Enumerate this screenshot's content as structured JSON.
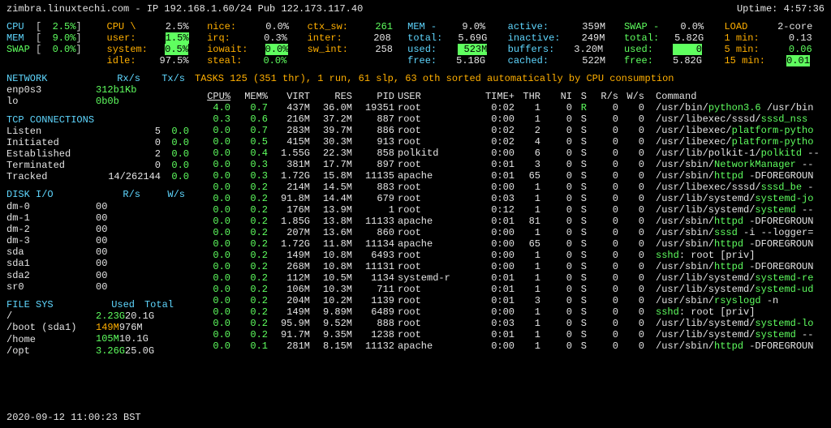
{
  "header": {
    "host": "zimbra.linuxtechi.com - IP 192.168.1.60/24 Pub 122.173.117.40",
    "uptime_label": "Uptime:",
    "uptime": "4:57:36"
  },
  "meters": {
    "cpu0": {
      "label": "CPU",
      "val": "2.5%"
    },
    "mem0": {
      "label": "MEM",
      "val": "9.0%"
    },
    "swap0": {
      "label": "SWAP",
      "val": "0.0%"
    },
    "cpu": {
      "label": "CPU \\",
      "val": "2.5%",
      "user": "user:",
      "user_v": "1.5%",
      "system": "system:",
      "system_v": "0.5%",
      "idle": "idle:",
      "idle_v": "97.5%"
    },
    "mid": {
      "nice": "nice:",
      "nice_v": "0.0%",
      "irq": "irq:",
      "irq_v": "0.3%",
      "iowait": "iowait:",
      "iowait_v": "0.0%",
      "steal": "steal:",
      "steal_v": "0.0%"
    },
    "ctx": {
      "ctx": "ctx_sw:",
      "ctx_v": "261",
      "inter": "inter:",
      "inter_v": "208",
      "swint": "sw_int:",
      "swint_v": "258"
    },
    "memd": {
      "label": "MEM -",
      "val": "9.0%",
      "total": "total:",
      "total_v": "5.69G",
      "used": "used:",
      "used_v": "523M",
      "free": "free:",
      "free_v": "5.18G"
    },
    "act": {
      "active": "active:",
      "active_v": "359M",
      "inactive": "inactive:",
      "inactive_v": "249M",
      "buffers": "buffers:",
      "buffers_v": "3.20M",
      "cached": "cached:",
      "cached_v": "522M"
    },
    "swap": {
      "label": "SWAP -",
      "val": "0.0%",
      "total": "total:",
      "total_v": "5.82G",
      "used": "used:",
      "used_v": "0",
      "free": "free:",
      "free_v": "5.82G"
    },
    "load": {
      "label": "LOAD",
      "cores": "2-core",
      "m1": "1 min:",
      "m1_v": "0.13",
      "m5": "5 min:",
      "m5_v": "0.06",
      "m15": "15 min:",
      "m15_v": "0.01"
    }
  },
  "network": {
    "title": "NETWORK",
    "rx": "Rx/s",
    "tx": "Tx/s",
    "rows": [
      {
        "if": "enp0s3",
        "rx": "312b",
        "tx": "1Kb"
      },
      {
        "if": "lo",
        "rx": "0b",
        "tx": "0b"
      }
    ]
  },
  "tcp": {
    "title": "TCP CONNECTIONS",
    "rows": [
      {
        "k": "Listen",
        "a": "5",
        "b": "0.0"
      },
      {
        "k": "Initiated",
        "a": "0",
        "b": "0.0"
      },
      {
        "k": "Established",
        "a": "2",
        "b": "0.0"
      },
      {
        "k": "Terminated",
        "a": "0",
        "b": "0.0"
      },
      {
        "k": "Tracked",
        "a": "14/262144",
        "b": "0.0"
      }
    ]
  },
  "disk": {
    "title": "DISK I/O",
    "r": "R/s",
    "w": "W/s",
    "rows": [
      {
        "d": "dm-0",
        "r": "0",
        "w": "0"
      },
      {
        "d": "dm-1",
        "r": "0",
        "w": "0"
      },
      {
        "d": "dm-2",
        "r": "0",
        "w": "0"
      },
      {
        "d": "dm-3",
        "r": "0",
        "w": "0"
      },
      {
        "d": "sda",
        "r": "0",
        "w": "0"
      },
      {
        "d": "sda1",
        "r": "0",
        "w": "0"
      },
      {
        "d": "sda2",
        "r": "0",
        "w": "0"
      },
      {
        "d": "sr0",
        "r": "0",
        "w": "0"
      }
    ]
  },
  "fs": {
    "title": "FILE SYS",
    "used": "Used",
    "total": "Total",
    "rows": [
      {
        "m": "/",
        "u": "2.23G",
        "t": "20.1G",
        "c": "gr"
      },
      {
        "m": "/boot (sda1)",
        "u": "149M",
        "t": "976M",
        "c": "ye"
      },
      {
        "m": "/home",
        "u": "105M",
        "t": "10.1G",
        "c": "gr"
      },
      {
        "m": "/opt",
        "u": "3.26G",
        "t": "25.0G",
        "c": "gr"
      }
    ]
  },
  "tasks": {
    "line": "TASKS 125 (351 thr), 1 run, 61 slp, 63 oth sorted automatically by CPU consumption"
  },
  "ph": {
    "cpu": "CPU%",
    "mem": "MEM%",
    "virt": "VIRT",
    "res": "RES",
    "pid": "PID",
    "user": "USER",
    "time": "TIME+",
    "thr": "THR",
    "ni": "NI",
    "s": "S",
    "rs": "R/s",
    "ws": "W/s",
    "cmd": "Command"
  },
  "procs": [
    {
      "cpu": "4.0",
      "mem": "0.7",
      "virt": "437M",
      "res": "36.0M",
      "pid": "19351",
      "user": "root",
      "time": "0:02",
      "thr": "1",
      "ni": "0",
      "s": "R",
      "rs": "0",
      "ws": "0",
      "cmd": [
        "/usr/bin/",
        "python3.6",
        " /usr/bin"
      ]
    },
    {
      "cpu": "0.3",
      "mem": "0.6",
      "virt": "216M",
      "res": "37.2M",
      "pid": "887",
      "user": "root",
      "time": "0:00",
      "thr": "1",
      "ni": "0",
      "s": "S",
      "rs": "0",
      "ws": "0",
      "cmd": [
        "/usr/libexec/sssd/",
        "sssd_nss",
        ""
      ]
    },
    {
      "cpu": "0.0",
      "mem": "0.7",
      "virt": "283M",
      "res": "39.7M",
      "pid": "886",
      "user": "root",
      "time": "0:02",
      "thr": "2",
      "ni": "0",
      "s": "S",
      "rs": "0",
      "ws": "0",
      "cmd": [
        "/usr/libexec/",
        "platform-pytho",
        ""
      ]
    },
    {
      "cpu": "0.0",
      "mem": "0.5",
      "virt": "415M",
      "res": "30.3M",
      "pid": "913",
      "user": "root",
      "time": "0:02",
      "thr": "4",
      "ni": "0",
      "s": "S",
      "rs": "0",
      "ws": "0",
      "cmd": [
        "/usr/libexec/",
        "platform-pytho",
        ""
      ]
    },
    {
      "cpu": "0.0",
      "mem": "0.4",
      "virt": "1.55G",
      "res": "22.3M",
      "pid": "858",
      "user": "polkitd",
      "time": "0:00",
      "thr": "6",
      "ni": "0",
      "s": "S",
      "rs": "0",
      "ws": "0",
      "cmd": [
        "/usr/lib/polkit-1/",
        "polkitd",
        " --"
      ]
    },
    {
      "cpu": "0.0",
      "mem": "0.3",
      "virt": "381M",
      "res": "17.7M",
      "pid": "897",
      "user": "root",
      "time": "0:01",
      "thr": "3",
      "ni": "0",
      "s": "S",
      "rs": "0",
      "ws": "0",
      "cmd": [
        "/usr/sbin/",
        "NetworkManager",
        " --"
      ]
    },
    {
      "cpu": "0.0",
      "mem": "0.3",
      "virt": "1.72G",
      "res": "15.8M",
      "pid": "11135",
      "user": "apache",
      "time": "0:01",
      "thr": "65",
      "ni": "0",
      "s": "S",
      "rs": "0",
      "ws": "0",
      "cmd": [
        "/usr/sbin/",
        "httpd",
        " -DFOREGROUN"
      ]
    },
    {
      "cpu": "0.0",
      "mem": "0.2",
      "virt": "214M",
      "res": "14.5M",
      "pid": "883",
      "user": "root",
      "time": "0:00",
      "thr": "1",
      "ni": "0",
      "s": "S",
      "rs": "0",
      "ws": "0",
      "cmd": [
        "/usr/libexec/sssd/",
        "sssd_be",
        " -"
      ]
    },
    {
      "cpu": "0.0",
      "mem": "0.2",
      "virt": "91.8M",
      "res": "14.4M",
      "pid": "679",
      "user": "root",
      "time": "0:03",
      "thr": "1",
      "ni": "0",
      "s": "S",
      "rs": "0",
      "ws": "0",
      "cmd": [
        "/usr/lib/systemd/",
        "systemd-jo",
        ""
      ]
    },
    {
      "cpu": "0.0",
      "mem": "0.2",
      "virt": "176M",
      "res": "13.9M",
      "pid": "1",
      "user": "root",
      "time": "0:12",
      "thr": "1",
      "ni": "0",
      "s": "S",
      "rs": "0",
      "ws": "0",
      "cmd": [
        "/usr/lib/systemd/",
        "systemd",
        " --"
      ]
    },
    {
      "cpu": "0.0",
      "mem": "0.2",
      "virt": "1.85G",
      "res": "13.8M",
      "pid": "11133",
      "user": "apache",
      "time": "0:01",
      "thr": "81",
      "ni": "0",
      "s": "S",
      "rs": "0",
      "ws": "0",
      "cmd": [
        "/usr/sbin/",
        "httpd",
        " -DFOREGROUN"
      ]
    },
    {
      "cpu": "0.0",
      "mem": "0.2",
      "virt": "207M",
      "res": "13.6M",
      "pid": "860",
      "user": "root",
      "time": "0:00",
      "thr": "1",
      "ni": "0",
      "s": "S",
      "rs": "0",
      "ws": "0",
      "cmd": [
        "/usr/sbin/",
        "sssd",
        " -i --logger="
      ]
    },
    {
      "cpu": "0.0",
      "mem": "0.2",
      "virt": "1.72G",
      "res": "11.8M",
      "pid": "11134",
      "user": "apache",
      "time": "0:00",
      "thr": "65",
      "ni": "0",
      "s": "S",
      "rs": "0",
      "ws": "0",
      "cmd": [
        "/usr/sbin/",
        "httpd",
        " -DFOREGROUN"
      ]
    },
    {
      "cpu": "0.0",
      "mem": "0.2",
      "virt": "149M",
      "res": "10.8M",
      "pid": "6493",
      "user": "root",
      "time": "0:00",
      "thr": "1",
      "ni": "0",
      "s": "S",
      "rs": "0",
      "ws": "0",
      "cmd": [
        "",
        "sshd",
        ": root [priv]"
      ]
    },
    {
      "cpu": "0.0",
      "mem": "0.2",
      "virt": "268M",
      "res": "10.8M",
      "pid": "11131",
      "user": "root",
      "time": "0:00",
      "thr": "1",
      "ni": "0",
      "s": "S",
      "rs": "0",
      "ws": "0",
      "cmd": [
        "/usr/sbin/",
        "httpd",
        " -DFOREGROUN"
      ]
    },
    {
      "cpu": "0.0",
      "mem": "0.2",
      "virt": "112M",
      "res": "10.5M",
      "pid": "1134",
      "user": "systemd-r",
      "time": "0:01",
      "thr": "1",
      "ni": "0",
      "s": "S",
      "rs": "0",
      "ws": "0",
      "cmd": [
        "/usr/lib/systemd/",
        "systemd-re",
        ""
      ]
    },
    {
      "cpu": "0.0",
      "mem": "0.2",
      "virt": "106M",
      "res": "10.3M",
      "pid": "711",
      "user": "root",
      "time": "0:01",
      "thr": "1",
      "ni": "0",
      "s": "S",
      "rs": "0",
      "ws": "0",
      "cmd": [
        "/usr/lib/systemd/",
        "systemd-ud",
        ""
      ]
    },
    {
      "cpu": "0.0",
      "mem": "0.2",
      "virt": "204M",
      "res": "10.2M",
      "pid": "1139",
      "user": "root",
      "time": "0:01",
      "thr": "3",
      "ni": "0",
      "s": "S",
      "rs": "0",
      "ws": "0",
      "cmd": [
        "/usr/sbin/",
        "rsyslogd",
        " -n"
      ]
    },
    {
      "cpu": "0.0",
      "mem": "0.2",
      "virt": "149M",
      "res": "9.89M",
      "pid": "6489",
      "user": "root",
      "time": "0:00",
      "thr": "1",
      "ni": "0",
      "s": "S",
      "rs": "0",
      "ws": "0",
      "cmd": [
        "",
        "sshd",
        ": root [priv]"
      ]
    },
    {
      "cpu": "0.0",
      "mem": "0.2",
      "virt": "95.9M",
      "res": "9.52M",
      "pid": "888",
      "user": "root",
      "time": "0:03",
      "thr": "1",
      "ni": "0",
      "s": "S",
      "rs": "0",
      "ws": "0",
      "cmd": [
        "/usr/lib/systemd/",
        "systemd-lo",
        ""
      ]
    },
    {
      "cpu": "0.0",
      "mem": "0.2",
      "virt": "91.7M",
      "res": "9.35M",
      "pid": "1238",
      "user": "root",
      "time": "0:01",
      "thr": "1",
      "ni": "0",
      "s": "S",
      "rs": "0",
      "ws": "0",
      "cmd": [
        "/usr/lib/systemd/",
        "systemd",
        " --"
      ]
    },
    {
      "cpu": "0.0",
      "mem": "0.1",
      "virt": "281M",
      "res": "8.15M",
      "pid": "11132",
      "user": "apache",
      "time": "0:00",
      "thr": "1",
      "ni": "0",
      "s": "S",
      "rs": "0",
      "ws": "0",
      "cmd": [
        "/usr/sbin/",
        "httpd",
        " -DFOREGROUN"
      ]
    }
  ],
  "footer": {
    "ts": "2020-09-12 11:00:23 BST"
  }
}
